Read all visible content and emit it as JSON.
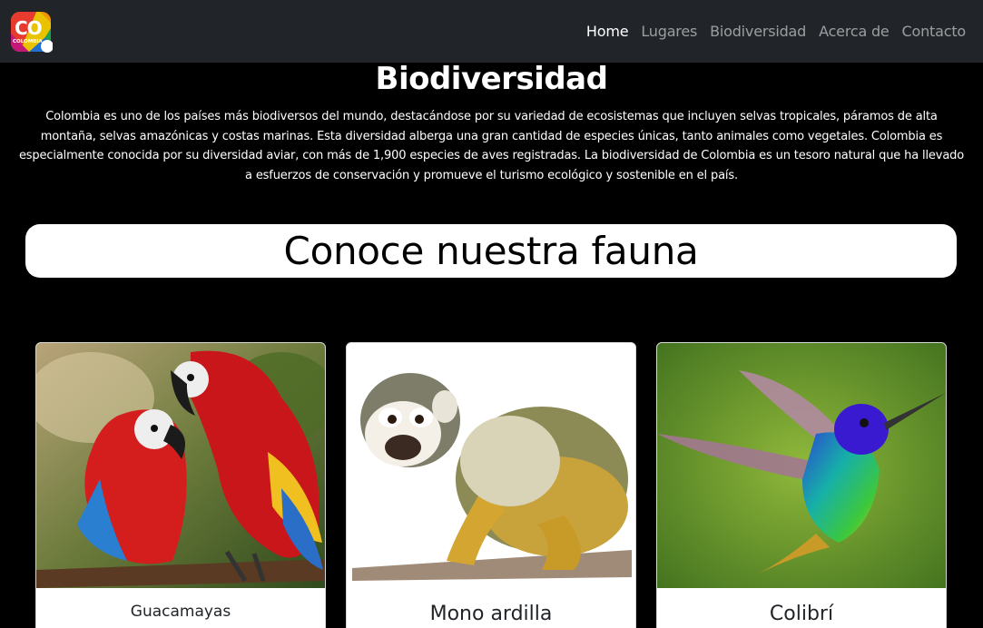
{
  "nav": {
    "logo": {
      "text": "CO",
      "subtext": "COLOMBIA"
    },
    "links": [
      {
        "label": "Home",
        "active": true
      },
      {
        "label": "Lugares",
        "active": false
      },
      {
        "label": "Biodiversidad",
        "active": false
      },
      {
        "label": "Acerca de",
        "active": false
      },
      {
        "label": "Contacto",
        "active": false
      }
    ]
  },
  "hero": {
    "title": "Biodiversidad",
    "intro": "Colombia es uno de los países más biodiversos del mundo, destacándose por su variedad de ecosistemas que incluyen selvas tropicales, páramos de alta montaña, selvas amazónicas y costas marinas. Esta diversidad alberga una gran cantidad de especies únicas, tanto animales como vegetales. Colombia es especialmente conocida por su diversidad aviar, con más de 1,900 especies de aves registradas. La biodiversidad de Colombia es un tesoro natural que ha llevado a esfuerzos de conservación y promueve el turismo ecológico y sostenible en el país."
  },
  "fauna": {
    "heading": "Conoce nuestra fauna",
    "cards": [
      {
        "title": "Guacamayas",
        "image": "macaws-photo"
      },
      {
        "title": "Mono ardilla",
        "image": "squirrel-monkey-photo"
      },
      {
        "title": "Colibrí",
        "image": "hummingbird-photo"
      }
    ]
  }
}
